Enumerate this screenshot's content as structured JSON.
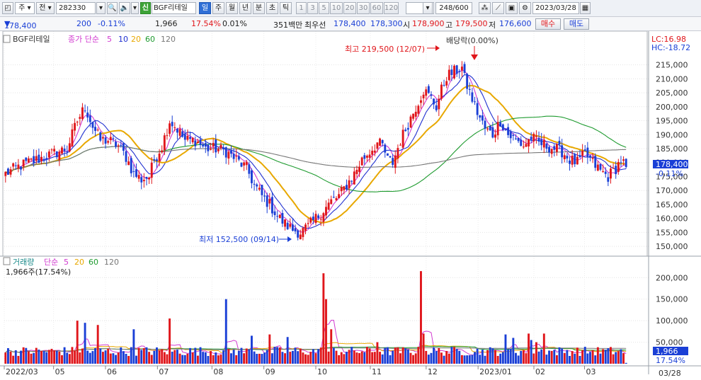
{
  "toolbar": {
    "market_label": "주",
    "prev_label": "전",
    "code": "282330",
    "new_badge": "신",
    "stock_name": "BGF리테일",
    "period_tabs": [
      "일",
      "주",
      "월",
      "년",
      "분",
      "초",
      "틱"
    ],
    "selected_period": "일",
    "interval_buttons": [
      "1",
      "3",
      "5",
      "10",
      "20",
      "30",
      "60",
      "120"
    ],
    "count": "248/600",
    "date": "2023/03/28"
  },
  "quote": {
    "price": "178,400",
    "change": "200",
    "change_pct": "-0.11%",
    "volume": "1,966",
    "volume_ratio": "17.54%",
    "turnover": "0.01%",
    "amount": "351백만",
    "best_quote_label": "최우선",
    "ask": "178,400",
    "bid": "178,300",
    "open_label": "시",
    "open": "178,900",
    "high_label": "고",
    "high": "179,500",
    "low_label": "저",
    "low": "176,600",
    "buy_label": "매수",
    "sell_label": "매도"
  },
  "colors": {
    "up": "#e0161b",
    "down": "#1a3fd6",
    "ma5": "#d23bd0",
    "ma10": "#2030d0",
    "ma20": "#e8a800",
    "ma60": "#1e9b2f",
    "ma120": "#777777"
  },
  "chart_data": [
    {
      "type": "candlestick",
      "title": "BGF리테일",
      "series_label": "종가 단순",
      "moving_averages": [
        "5",
        "10",
        "20",
        "60",
        "120"
      ],
      "ylim": [
        148000,
        222000
      ],
      "y_ticks": [
        "150,000",
        "155,000",
        "160,000",
        "165,000",
        "170,000",
        "175,000",
        "180,000",
        "185,000",
        "190,000",
        "195,000",
        "200,000",
        "205,000",
        "210,000",
        "215,000"
      ],
      "x_ticks": [
        "2022/03",
        "05",
        "06",
        "07",
        "08",
        "09",
        "10",
        "11",
        "12",
        "2023/01",
        "02",
        "03"
      ],
      "last_date_label": "03/28",
      "last_price_label": "178,400",
      "last_change_label": "-0.11%",
      "lc_label": "LC:16.98",
      "hc_label": "HC:-18.72",
      "annotations": {
        "high": "최고 219,500 (12/07)",
        "low": "최저 152,500 (09/14)",
        "dividend": "배당락(0.00%)"
      },
      "anchors": [
        [
          0,
          176000
        ],
        [
          6,
          179000
        ],
        [
          12,
          181000
        ],
        [
          18,
          183000
        ],
        [
          24,
          185000
        ],
        [
          28,
          195000
        ],
        [
          31,
          200000
        ],
        [
          34,
          193000
        ],
        [
          37,
          188000
        ],
        [
          40,
          188000
        ],
        [
          44,
          186000
        ],
        [
          47,
          182000
        ],
        [
          50,
          176000
        ],
        [
          53,
          174000
        ],
        [
          56,
          175000
        ],
        [
          58,
          181000
        ],
        [
          61,
          186000
        ],
        [
          64,
          195000
        ],
        [
          67,
          192000
        ],
        [
          70,
          188000
        ],
        [
          74,
          188000
        ],
        [
          78,
          185000
        ],
        [
          82,
          185000
        ],
        [
          86,
          184000
        ],
        [
          90,
          181000
        ],
        [
          94,
          178000
        ],
        [
          97,
          172000
        ],
        [
          100,
          168000
        ],
        [
          103,
          165000
        ],
        [
          106,
          161000
        ],
        [
          109,
          158000
        ],
        [
          112,
          156000
        ],
        [
          115,
          155000
        ],
        [
          118,
          157000
        ],
        [
          121,
          160000
        ],
        [
          124,
          163000
        ],
        [
          127,
          166000
        ],
        [
          130,
          168000
        ],
        [
          133,
          172000
        ],
        [
          136,
          176000
        ],
        [
          139,
          181000
        ],
        [
          142,
          184000
        ],
        [
          145,
          187000
        ],
        [
          147,
          186000
        ],
        [
          149,
          181000
        ],
        [
          151,
          180000
        ],
        [
          154,
          188000
        ],
        [
          157,
          194000
        ],
        [
          160,
          200000
        ],
        [
          163,
          206000
        ],
        [
          166,
          203000
        ],
        [
          168,
          200000
        ],
        [
          170,
          206000
        ],
        [
          172,
          211000
        ],
        [
          174,
          212000
        ],
        [
          176,
          213000
        ],
        [
          178,
          214000
        ],
        [
          179,
          210000
        ],
        [
          181,
          205000
        ],
        [
          184,
          198000
        ],
        [
          187,
          192000
        ],
        [
          190,
          190000
        ],
        [
          193,
          195000
        ],
        [
          196,
          190000
        ],
        [
          199,
          188000
        ],
        [
          202,
          186000
        ],
        [
          205,
          189000
        ],
        [
          208,
          187000
        ],
        [
          211,
          186000
        ],
        [
          214,
          185000
        ],
        [
          217,
          184000
        ],
        [
          220,
          181000
        ],
        [
          223,
          180000
        ],
        [
          226,
          183000
        ],
        [
          229,
          180000
        ],
        [
          232,
          177000
        ],
        [
          235,
          175000
        ],
        [
          238,
          178000
        ],
        [
          240,
          181000
        ],
        [
          242,
          178400
        ]
      ],
      "ma_params": [
        5,
        10,
        20,
        60,
        120
      ]
    },
    {
      "type": "bar",
      "title": "거래량",
      "series_label": "단순",
      "moving_averages": [
        "5",
        "20",
        "60",
        "120"
      ],
      "current_label": "1,966주(17.54%)",
      "ylim": [
        0,
        230000
      ],
      "y_ticks": [
        "50,000",
        "100,000",
        "150,000",
        "200,000"
      ],
      "last_value_label": "1,966",
      "last_pct_label": "17.54%",
      "spikes": [
        [
          28,
          100000
        ],
        [
          31,
          95000
        ],
        [
          36,
          90000
        ],
        [
          50,
          80000
        ],
        [
          64,
          105000
        ],
        [
          86,
          150000
        ],
        [
          96,
          65000
        ],
        [
          103,
          68000
        ],
        [
          110,
          62000
        ],
        [
          124,
          210000
        ],
        [
          125,
          150000
        ],
        [
          127,
          80000
        ],
        [
          145,
          50000
        ],
        [
          162,
          215000
        ],
        [
          163,
          70000
        ],
        [
          195,
          68000
        ],
        [
          198,
          60000
        ],
        [
          204,
          70000
        ],
        [
          205,
          55000
        ],
        [
          207,
          50000
        ],
        [
          210,
          70000
        ]
      ]
    }
  ]
}
